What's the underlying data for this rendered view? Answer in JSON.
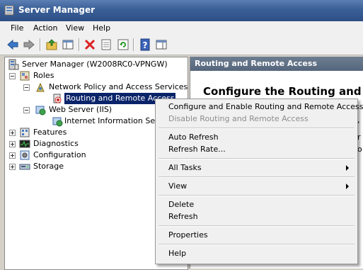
{
  "window": {
    "title": "Server Manager"
  },
  "menubar": {
    "items": [
      "File",
      "Action",
      "View",
      "Help"
    ]
  },
  "toolbar": {
    "buttons": [
      "back-icon",
      "forward-icon",
      "up-folder-icon",
      "show-hide-tree-icon",
      "delete-icon",
      "properties-icon",
      "refresh-icon",
      "help-icon",
      "show-hide-action-pane-icon"
    ]
  },
  "tree": {
    "root": "Server Manager (W2008RC0-VPNGW)",
    "roles": "Roles",
    "npas": "Network Policy and Access Services",
    "rras": "Routing and Remote Access",
    "webserver": "Web Server (IIS)",
    "iis": "Internet Information Servic",
    "features": "Features",
    "diagnostics": "Diagnostics",
    "configuration": "Configuration",
    "storage": "Storage"
  },
  "right": {
    "header": "Routing and Remote Access",
    "title": "Configure the Routing and Re",
    "fragments": [
      ",",
      "r",
      "o"
    ]
  },
  "context_menu": {
    "configure": "Configure and Enable Routing and Remote Access",
    "disable": "Disable Routing and Remote Access",
    "auto_refresh": "Auto Refresh",
    "refresh_rate": "Refresh Rate...",
    "all_tasks": "All Tasks",
    "view": "View",
    "delete": "Delete",
    "refresh": "Refresh",
    "properties": "Properties",
    "help": "Help"
  },
  "colors": {
    "selection": "#0a246a",
    "titlebar": "#3a5f96",
    "pane_header": "#5f7086"
  }
}
